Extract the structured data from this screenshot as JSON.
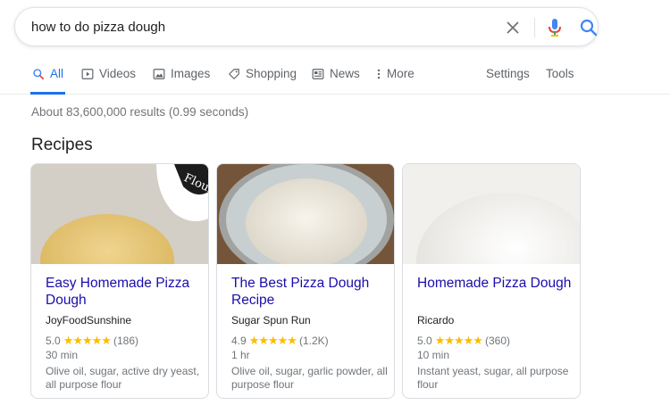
{
  "search": {
    "query": "how to do pizza dough"
  },
  "tabs": [
    {
      "label": "All",
      "active": true,
      "icon": "search-icon"
    },
    {
      "label": "Videos",
      "icon": "video-icon"
    },
    {
      "label": "Images",
      "icon": "image-icon"
    },
    {
      "label": "Shopping",
      "icon": "tag-icon"
    },
    {
      "label": "News",
      "icon": "news-icon"
    },
    {
      "label": "More",
      "icon": "more-vert-icon"
    }
  ],
  "tools": {
    "settings": "Settings",
    "tools": "Tools"
  },
  "results": {
    "stats": "About 83,600,000 results (0.99 seconds)"
  },
  "recipes": {
    "title": "Recipes",
    "items": [
      {
        "title": "Easy Homemade Pizza Dough",
        "source": "JoyFoodSunshine",
        "rating": "5.0",
        "stars": "★★★★★",
        "reviews": "(186)",
        "time": "30 min",
        "ingredients": "Olive oil, sugar, active dry yeast, all purpose flour",
        "image_hint": "flour-bag-dough-ball"
      },
      {
        "title": "The Best Pizza Dough Recipe",
        "source": "Sugar Spun Run",
        "rating": "4.9",
        "stars": "★★★★★",
        "reviews": "(1.2K)",
        "time": "1 hr",
        "ingredients": "Olive oil, sugar, garlic powder, all purpose flour",
        "image_hint": "dough-in-glass-bowl"
      },
      {
        "title": "Homemade Pizza Dough",
        "source": "Ricardo",
        "rating": "5.0",
        "stars": "★★★★★",
        "reviews": "(360)",
        "time": "10 min",
        "ingredients": "Instant yeast, sugar, all purpose flour",
        "image_hint": "floured-dough-ball"
      }
    ]
  },
  "colors": {
    "link": "#1a0dab",
    "accent": "#1a73e8",
    "star": "#fbbc04",
    "muted": "#70757a"
  }
}
